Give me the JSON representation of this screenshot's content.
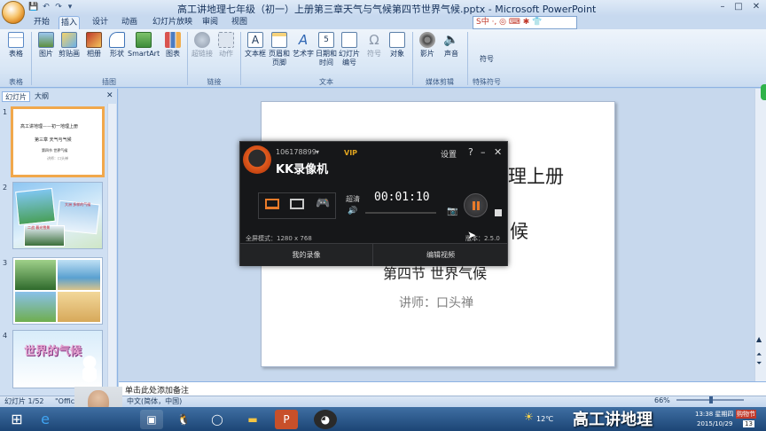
{
  "window": {
    "title": "高工讲地理七年级（初一）上册第三章天气与气候第四节世界气候.pptx - Microsoft PowerPoint",
    "minimize": "–",
    "maximize": "□",
    "close": "✕"
  },
  "quick_access": [
    "💾",
    "↶",
    "↷",
    "▾"
  ],
  "tabs": [
    "开始",
    "插入",
    "设计",
    "动画",
    "幻灯片放映",
    "审阅",
    "视图"
  ],
  "active_tab": "插入",
  "ribbon": {
    "groups": [
      {
        "label": "表格",
        "buttons": [
          "表格"
        ]
      },
      {
        "label": "插图",
        "buttons": [
          "图片",
          "剪贴画",
          "相册",
          "形状",
          "SmartArt",
          "图表"
        ]
      },
      {
        "label": "链接",
        "buttons": [
          "超链接",
          "动作"
        ]
      },
      {
        "label": "文本",
        "buttons": [
          "文本框",
          "页眉和页脚",
          "艺术字",
          "日期和时间",
          "幻灯片编号",
          "符号",
          "对象"
        ]
      },
      {
        "label": "媒体剪辑",
        "buttons": [
          "影片",
          "声音"
        ]
      },
      {
        "label": "特殊符号",
        "buttons": [
          "符号"
        ]
      }
    ],
    "ime_bar": "S中 ·, ◎ ⌨ ✱ 👕"
  },
  "panel": {
    "tabs": [
      "幻灯片",
      "大纲"
    ],
    "close": "✕",
    "slide_numbers": [
      "1",
      "2",
      "3",
      "4"
    ],
    "thumb1": {
      "line1": "高工讲地理——初一地理上册",
      "line2": "第三章 天气与气候",
      "line3": "第四节 世界气候",
      "line4": "讲师：口头禅"
    },
    "thumb2_label1": "大洲 多样的气候",
    "thumb2_label2": "二战 暮光雪景",
    "thumb4_title": "世界的气候"
  },
  "slide": {
    "line_book": "理上册",
    "line_chapter": "候",
    "line_section": "第四节 世界气候",
    "line_teacher": "讲师：口头禅"
  },
  "notes_placeholder": "单击此处添加备注",
  "status": {
    "slide_index": "幻灯片 1/52",
    "theme": "\"Office 主题\"",
    "language": "中文(简体，中国)",
    "zoom": "66%"
  },
  "recorder": {
    "account": "106178899",
    "vip": "VIP",
    "brand": "KK录像机",
    "settings": "设置",
    "help": "?",
    "minimize": "–",
    "close": "✕",
    "quality": "超清",
    "timer": "00:01:10",
    "mode_label": "全屏模式：1280 x 768",
    "version": "版本：2.5.0",
    "my_videos": "我的录像",
    "edit_video": "编辑视频"
  },
  "taskbar": {
    "overlay_text": "高工讲地理",
    "temperature": "12℃",
    "time": "13:38 星期四",
    "date": "2015/10/29",
    "corner_badge": "购物节",
    "corner_num": "13"
  }
}
